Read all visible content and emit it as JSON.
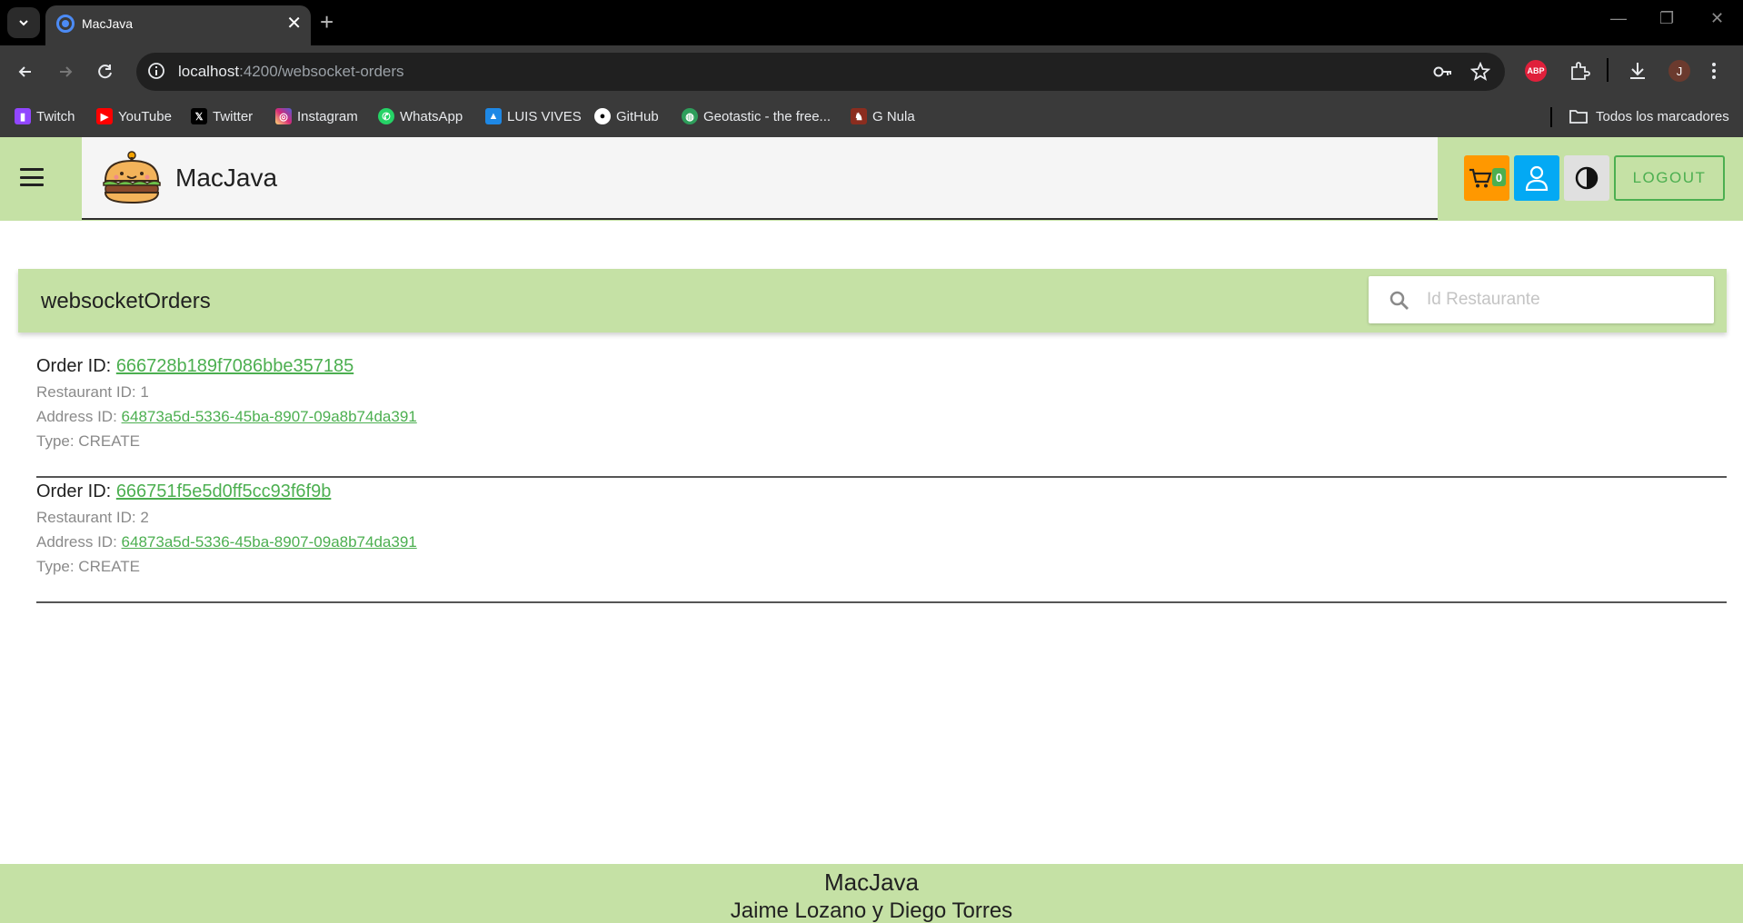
{
  "browser": {
    "tab_title": "MacJava",
    "url_host": "localhost",
    "url_path": ":4200/websocket-orders",
    "avatar_initial": "J",
    "abp_label": "ABP",
    "bookmarks": [
      {
        "label": "Twitch",
        "icon": "twitch-icon",
        "color": "#9146ff"
      },
      {
        "label": "YouTube",
        "icon": "youtube-icon",
        "color": "#ff0000"
      },
      {
        "label": "Twitter",
        "icon": "x-icon",
        "color": "#000000"
      },
      {
        "label": "Instagram",
        "icon": "instagram-icon",
        "color": "#d62976"
      },
      {
        "label": "WhatsApp",
        "icon": "whatsapp-icon",
        "color": "#25d366"
      },
      {
        "label": "LUIS VIVES",
        "icon": "graduation-cap-icon",
        "color": "#1e88e5"
      },
      {
        "label": "GitHub",
        "icon": "github-icon",
        "color": "#ffffff"
      },
      {
        "label": "Geotastic - the free...",
        "icon": "globe-icon",
        "color": "#2e9e5b"
      },
      {
        "label": "G Nula",
        "icon": "gnula-icon",
        "color": "#8b2d1f"
      }
    ],
    "all_bookmarks_label": "Todos los marcadores"
  },
  "header": {
    "brand": "MacJava",
    "cart_count": "0",
    "logout_label": "LOGOUT",
    "accent": "#c5e1a5"
  },
  "section": {
    "title": "websocketOrders",
    "search_placeholder": "Id Restaurante"
  },
  "orders": [
    {
      "order_label": "Order ID:",
      "order_id": "666728b189f7086bbe357185",
      "restaurant_label": "Restaurant ID: 1",
      "address_label": "Address ID:",
      "address_id": "64873a5d-5336-45ba-8907-09a8b74da391",
      "type_label": "Type: CREATE"
    },
    {
      "order_label": "Order ID:",
      "order_id": "666751f5e5d0ff5cc93f6f9b",
      "restaurant_label": "Restaurant ID: 2",
      "address_label": "Address ID:",
      "address_id": "64873a5d-5336-45ba-8907-09a8b74da391",
      "type_label": "Type: CREATE"
    }
  ],
  "footer": {
    "title": "MacJava",
    "authors": "Jaime Lozano y Diego Torres"
  }
}
